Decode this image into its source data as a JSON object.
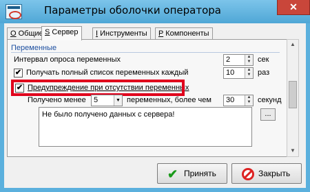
{
  "window": {
    "title": "Параметры оболочки операторa",
    "close_symbol": "✕"
  },
  "tabs": [
    {
      "key": "О",
      "label": "Общие"
    },
    {
      "key": "S",
      "label": "Сервер"
    },
    {
      "key": "I",
      "label": "Инструменты"
    },
    {
      "key": "P",
      "label": "Компоненты"
    }
  ],
  "section": {
    "title": "Переменные",
    "poll_interval_label": "Интервал опроса переменных",
    "poll_interval_value": "2",
    "poll_interval_unit": "сек",
    "full_list_label": "Получать полный список переменных каждый",
    "full_list_value": "10",
    "full_list_unit": "раз",
    "warn_label": "Предупреждение при отсутствии переменных",
    "warn_checked": "✔",
    "received_less_label": "Получено менее",
    "received_less_value": "5",
    "vars_more_than_label": "переменных, более чем",
    "seconds_value": "30",
    "seconds_unit": "секунд",
    "message_text": "Не было получено данных с сервера!",
    "ellipsis_button": "..."
  },
  "buttons": {
    "apply": "Принять",
    "close": "Закрыть"
  }
}
